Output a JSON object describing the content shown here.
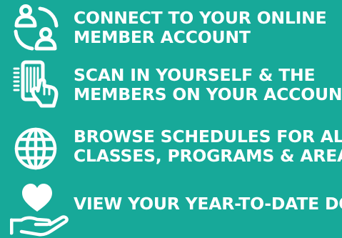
{
  "colors": {
    "background": "#17a999",
    "foreground": "#ffffff"
  },
  "features": [
    {
      "icon": "account-connect-icon",
      "lines": [
        "CONNECT TO YOUR ONLINE",
        "MEMBER ACCOUNT"
      ]
    },
    {
      "icon": "phone-scan-icon",
      "lines": [
        "SCAN IN YOURSELF & THE",
        "MEMBERS ON YOUR ACCOUNT"
      ]
    },
    {
      "icon": "globe-icon",
      "lines": [
        "BROWSE SCHEDULES FOR ALL",
        "CLASSES, PROGRAMS & AREAS"
      ]
    },
    {
      "icon": "heart-hand-icon",
      "lines": [
        "VIEW YOUR YEAR-TO-DATE DONATIONS"
      ]
    }
  ]
}
